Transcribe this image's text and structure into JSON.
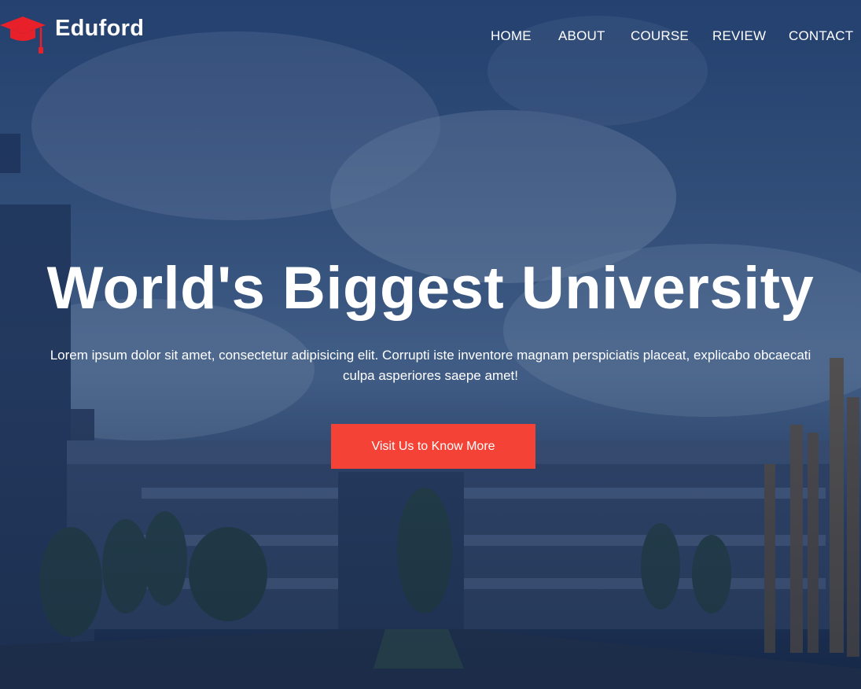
{
  "brand": {
    "name": "Eduford",
    "icon": "graduation-cap-icon",
    "icon_color": "#e8202a"
  },
  "nav": {
    "items": [
      {
        "label": "HOME"
      },
      {
        "label": "ABOUT"
      },
      {
        "label": "COURSE"
      },
      {
        "label": "REVIEW"
      },
      {
        "label": "CONTACT"
      }
    ]
  },
  "hero": {
    "title": "World's Biggest University",
    "description": "Lorem ipsum dolor sit amet, consectetur adipisicing elit. Corrupti iste inventore magnam perspiciatis placeat, explicabo obcaecati culpa asperiores saepe amet!",
    "cta_label": "Visit Us to Know More",
    "cta_color": "#f44336",
    "overlay_color": "#122c5c"
  }
}
